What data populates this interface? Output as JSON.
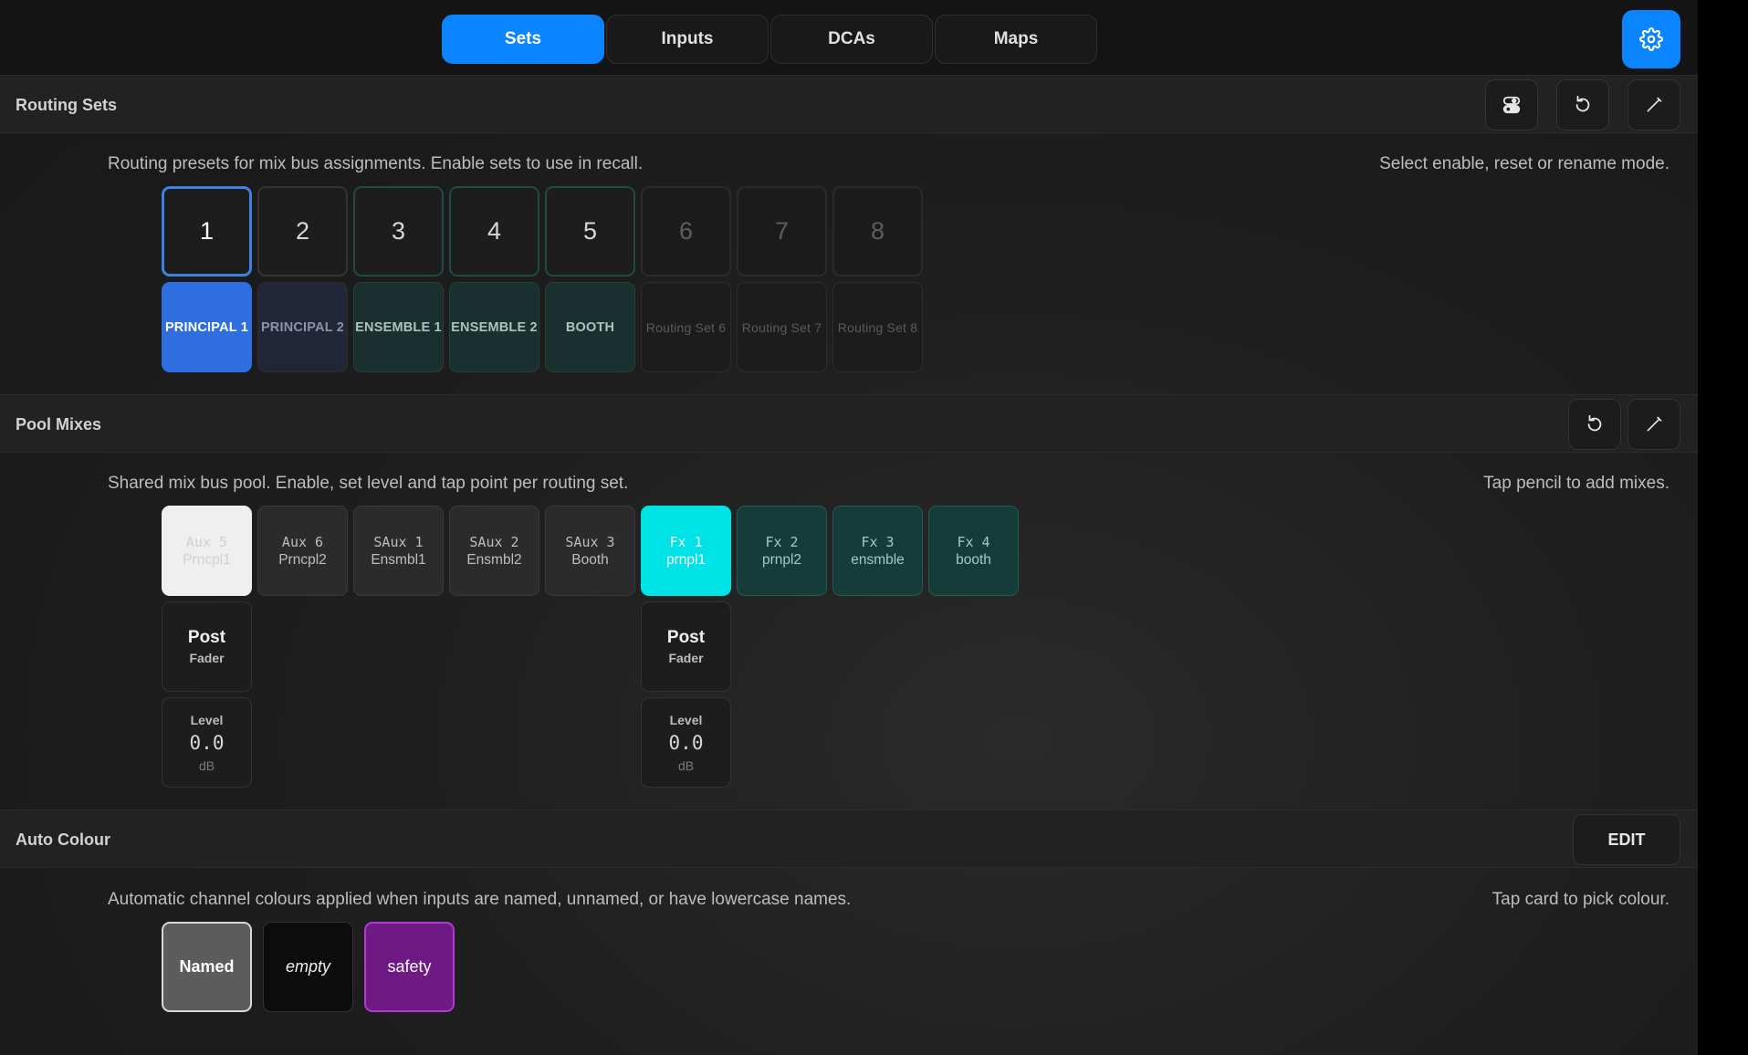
{
  "tabs": [
    {
      "label": "Sets",
      "active": true
    },
    {
      "label": "Inputs",
      "active": false
    },
    {
      "label": "DCAs",
      "active": false
    },
    {
      "label": "Maps",
      "active": false
    }
  ],
  "settings_icon": "gear-icon",
  "routing_sets": {
    "title": "Routing Sets",
    "description": "Routing presets for mix bus assignments. Enable sets to use in recall.",
    "hint": "Select enable, reset or rename mode.",
    "buttons": [
      "toggle-icon",
      "reset-icon",
      "pencil-icon"
    ],
    "numbers": [
      "1",
      "2",
      "3",
      "4",
      "5",
      "6",
      "7",
      "8"
    ],
    "names": [
      "PRINCIPAL 1",
      "PRINCIPAL 2",
      "ENSEMBLE 1",
      "ENSEMBLE 2",
      "BOOTH",
      "Routing Set 6",
      "Routing Set 7",
      "Routing Set 8"
    ],
    "selected": "1"
  },
  "pool_mixes": {
    "title": "Pool Mixes",
    "description": "Shared mix bus pool. Enable, set level and tap point per routing set.",
    "hint": "Tap pencil to add mixes.",
    "buttons": [
      "reset-icon",
      "pencil-icon"
    ],
    "mixes": [
      {
        "name": "Aux 5",
        "sub": "Prncpl1"
      },
      {
        "name": "Aux 6",
        "sub": "Prncpl2"
      },
      {
        "name": "SAux 1",
        "sub": "Ensmbl1"
      },
      {
        "name": "SAux 2",
        "sub": "Ensmbl2"
      },
      {
        "name": "SAux 3",
        "sub": "Booth"
      },
      {
        "name": "Fx 1",
        "sub": "prnpl1"
      },
      {
        "name": "Fx 2",
        "sub": "prnpl2"
      },
      {
        "name": "Fx 3",
        "sub": "ensmble"
      },
      {
        "name": "Fx 4",
        "sub": "booth"
      }
    ],
    "tap_point": {
      "main": "Post",
      "sub": "Fader"
    },
    "level": {
      "label": "Level",
      "value": "0.0",
      "unit": "dB"
    }
  },
  "auto_colour": {
    "title": "Auto Colour",
    "edit_label": "EDIT",
    "description": "Automatic channel colours applied when inputs are named, unnamed, or have lowercase names.",
    "hint": "Tap card to pick colour.",
    "cards": [
      "Named",
      "empty",
      "safety"
    ]
  },
  "colors": {
    "accent": "#0a84ff",
    "selected_set": "#2f6ee0",
    "fx_active": "#00e3e6",
    "safety": "#6f1a84"
  }
}
